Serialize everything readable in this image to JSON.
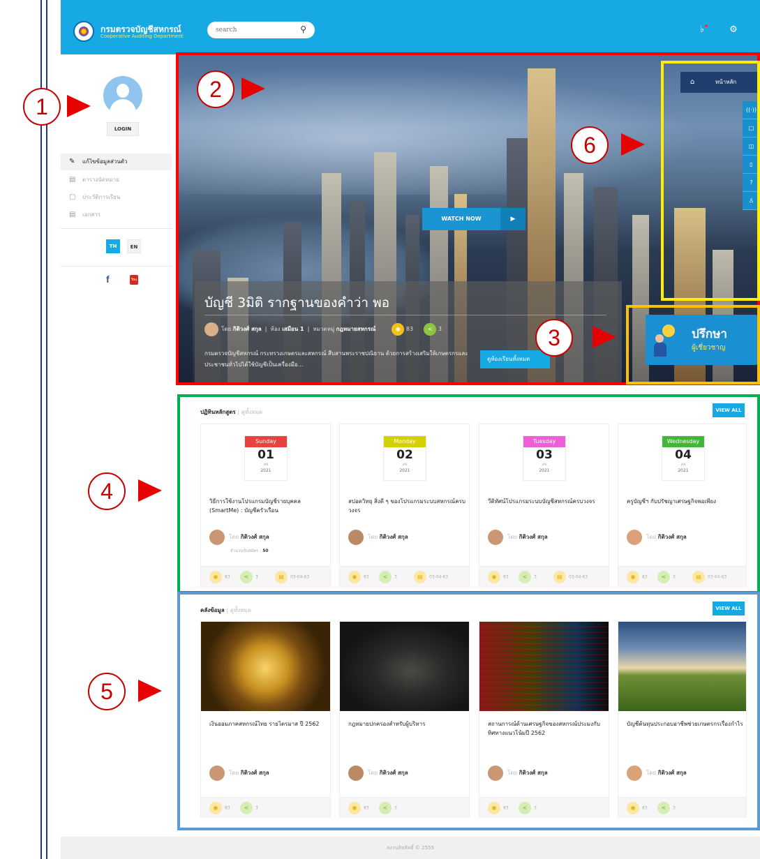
{
  "header": {
    "brand_th": "กรมตรวจบัญชีสหกรณ์",
    "brand_en": "Cooperative Auditing Department",
    "search_placeholder": "search"
  },
  "sidebar": {
    "login": "LOGIN",
    "menu": [
      {
        "label": "แก้ไขข้อมูลส่วนตัว",
        "active": true
      },
      {
        "label": "ตารางนัดหมาย",
        "active": false
      },
      {
        "label": "ประวัติการเรียน",
        "active": false
      },
      {
        "label": "เอกสาร",
        "active": false
      }
    ],
    "lang": [
      "TH",
      "EN"
    ],
    "social": [
      "f",
      "You Tube"
    ]
  },
  "hero": {
    "watch_now": "WATCH NOW",
    "title": "บัญชี 3มิติ รากฐานของคำว่า พอ",
    "meta": {
      "by_label": "โดย",
      "author": "กิติวงศ์ สกุล",
      "room_label": "ห้อง",
      "room": "เสมือน 1",
      "cat_label": "หมวดหมู่",
      "category": "กฎหมายสหกรณ์",
      "views": "83",
      "shares": "3"
    },
    "description": "กรมตรวจบัญชีสหกรณ์ กระทรวงเกษตรและสหกรณ์ สืบสานพระราชปณิธาน ด้วยการสร้างเสริมให้เกษตรกรและประชาชนทั่วไปได้ใช้บัญชีเป็นเครื่องมือ...",
    "room_button": "ดูห้องเรียนทั้งหมด",
    "nav_home": "หน้าหลัก",
    "consult_title": "ปรึกษา",
    "consult_sub": "ผู้เชี่ยวชาญ"
  },
  "calendar_section": {
    "title": "ปฏิทินหลักสูตร",
    "sub": "ดูทั้งหมด",
    "view_all": "VIEW ALL",
    "cards": [
      {
        "day": "Sunday",
        "date": "01",
        "month": "JAN",
        "year": "2021",
        "color": "#e8423f",
        "title": "วิธีการใช้งานโปรแกรมบัญชีรายบุคคล (SmartMe) : บัญชีครัวเรือน",
        "by": "โดย",
        "author": "กิติวงศ์ สกุล",
        "enroll_label": "จำนวนรับสมัคร :",
        "enroll": "50",
        "views": "83",
        "shares": "3",
        "date_short": "03-04-63"
      },
      {
        "day": "Monday",
        "date": "02",
        "month": "JAN",
        "year": "2021",
        "color": "#d4d100",
        "title": "สปอตวิทยุ สิ่งดี ๆ ของโปรแกรมระบบสหกรณ์ครบวงจร",
        "by": "โดย",
        "author": "กิติวงศ์ สกุล",
        "views": "83",
        "shares": "3",
        "date_short": "03-04-63"
      },
      {
        "day": "Tuesday",
        "date": "03",
        "month": "JAN",
        "year": "2021",
        "color": "#ec5fd7",
        "title": "วีดิทัศน์โปรแกรมระบบบัญชีสหกรณ์ครบวงจร",
        "by": "โดย",
        "author": "กิติวงศ์ สกุล",
        "views": "83",
        "shares": "3",
        "date_short": "03-04-63"
      },
      {
        "day": "Wednesday",
        "date": "04",
        "month": "JAN",
        "year": "2021",
        "color": "#43b63a",
        "title": "ครูบัญชีฯ กับปรัชญาเศรษฐกิจพอเพียง",
        "by": "โดย",
        "author": "กิติวงศ์ สกุล",
        "views": "83",
        "shares": "3",
        "date_short": "03-04-63"
      }
    ]
  },
  "library_section": {
    "title": "คลังข้อมูล",
    "sub": "ดูทั้งหมด",
    "view_all": "VIEW ALL",
    "cards": [
      {
        "title": "เงินออมภาคสหกรณ์ไทย รายไตรมาส ปี 2562",
        "by": "โดย",
        "author": "กิติวงศ์ สกุล",
        "views": "83",
        "shares": "3"
      },
      {
        "title": "กฎหมายปกครองสำหรับผู้บริหาร",
        "by": "โดย",
        "author": "กิติวงศ์ สกุล",
        "views": "83",
        "shares": "3"
      },
      {
        "title": "สถานการณ์ด้านเศรษฐกิจของสหกรณ์ประมงกับทิศทางแนวโน้มปี 2562",
        "by": "โดย",
        "author": "กิติวงศ์ สกุล",
        "views": "83",
        "shares": "3"
      },
      {
        "title": "บัญชีต้นทุนประกอบอาชีพช่วยเกษตรกรเรื่องกำไร",
        "by": "โดย",
        "author": "กิติวงศ์ สกุล",
        "views": "83",
        "shares": "3"
      }
    ]
  },
  "footer": {
    "text": "สงวนลิขสิทธิ์ © 2559"
  },
  "annotations": [
    "1",
    "2",
    "3",
    "4",
    "5",
    "6"
  ],
  "colors": {
    "primary": "#17a9e4",
    "annotation_red": "#e60000",
    "box_red": "#ff0000",
    "box_yellow": "#ffee00",
    "box_orange": "#ffc000",
    "box_green": "#00b050",
    "box_blue": "#5b9bd5"
  }
}
